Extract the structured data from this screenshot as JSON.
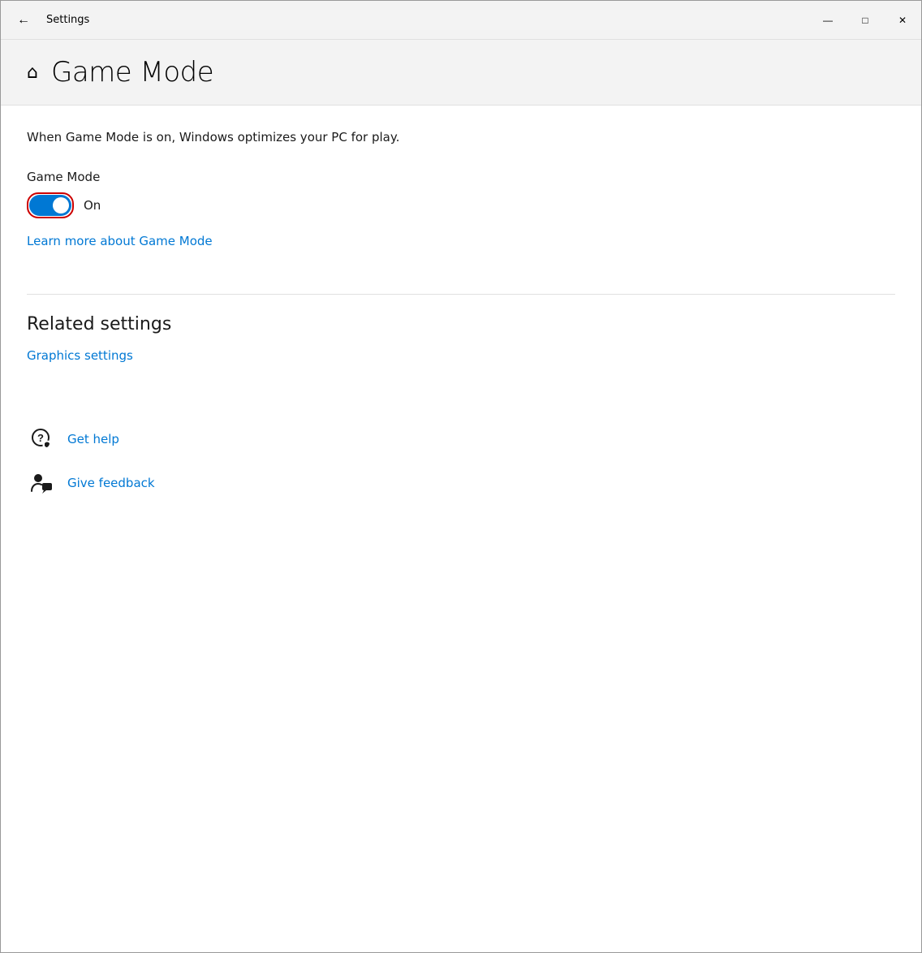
{
  "window": {
    "title": "Settings",
    "controls": {
      "minimize": "—",
      "maximize": "□",
      "close": "✕"
    }
  },
  "header": {
    "home_icon": "⌂",
    "title": "Game Mode"
  },
  "content": {
    "description": "When Game Mode is on, Windows optimizes your PC for play.",
    "game_mode_label": "Game Mode",
    "toggle_state": "On",
    "learn_more_link": "Learn more about Game Mode",
    "related_settings_heading": "Related settings",
    "graphics_settings_link": "Graphics settings",
    "get_help_label": "Get help",
    "give_feedback_label": "Give feedback"
  }
}
